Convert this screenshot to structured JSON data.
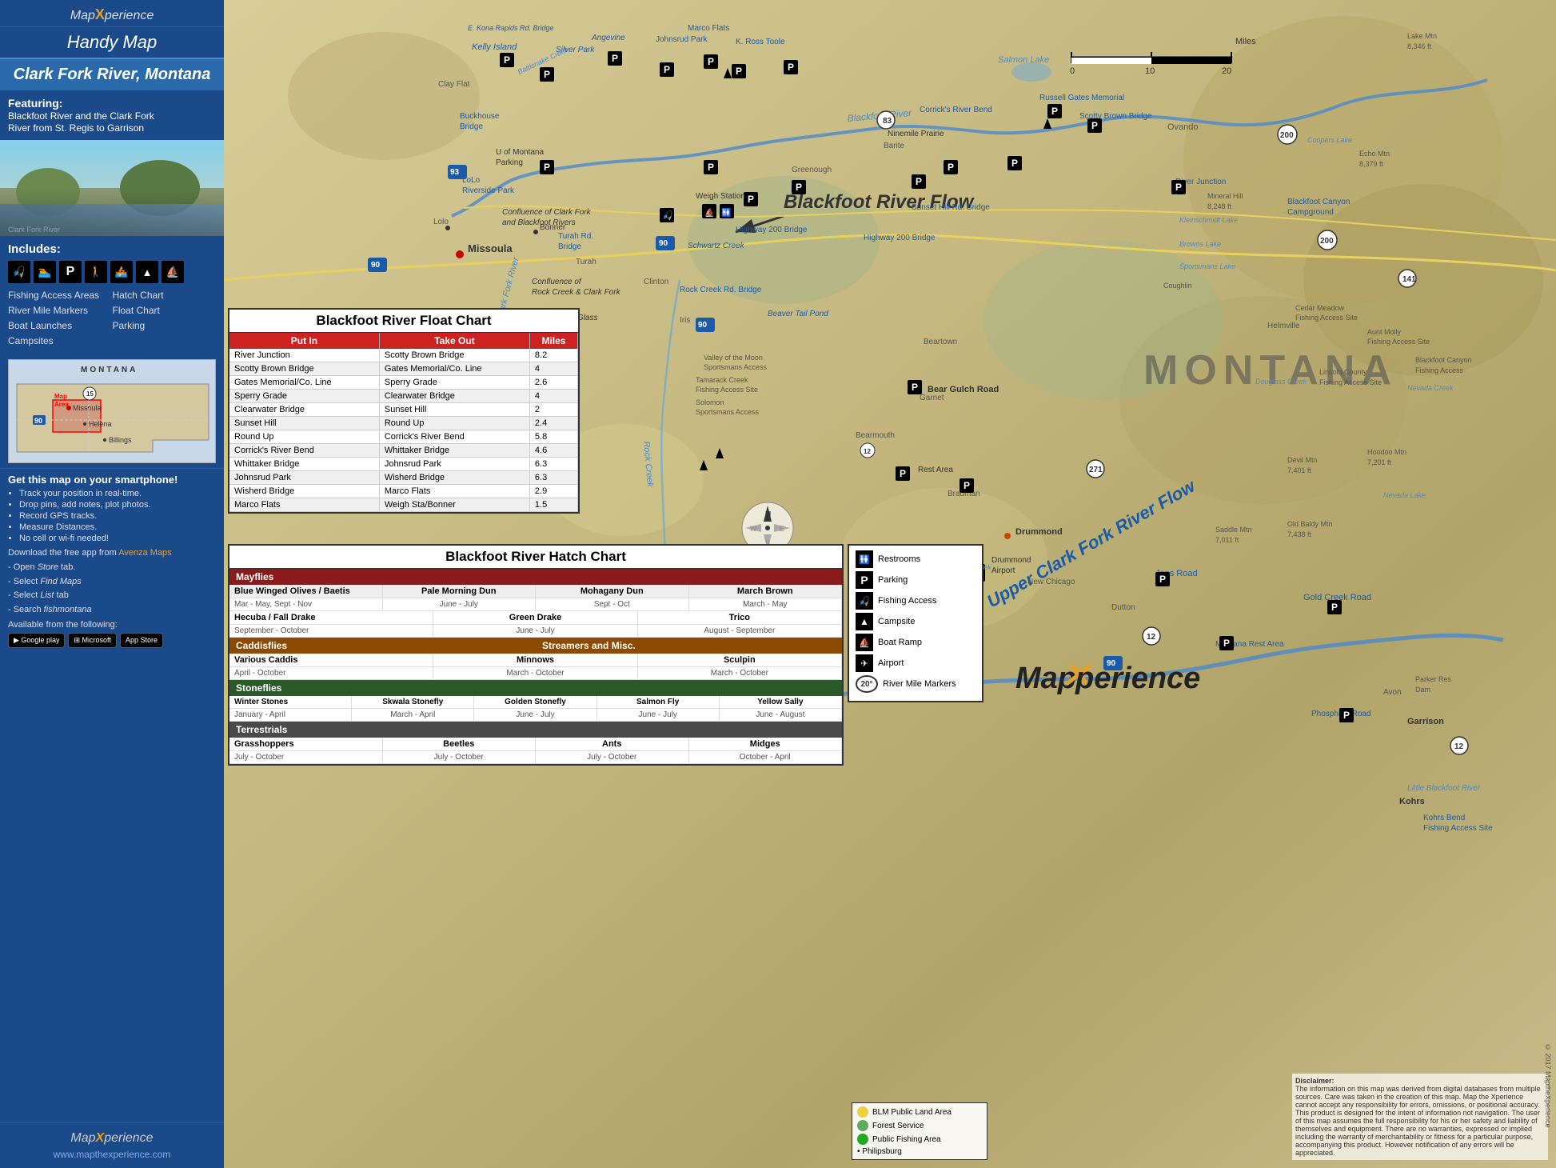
{
  "sidebar": {
    "logo": "Map",
    "logo_x": "X",
    "logo_suffix": "perience",
    "handy_map": "Handy Map",
    "river_title": "Clark Fork River, Montana",
    "featuring_label": "Featuring:",
    "featuring_text": "Blackfoot River and the Clark Fork\nRiver from St. Regis to Garrison",
    "includes_title": "Includes:",
    "includes_items": [
      "Fishing Access Areas",
      "Hatch Chart",
      "River Mile Markers",
      "Float Chart",
      "Boat Launches",
      "Parking",
      "Campsites",
      ""
    ],
    "smartphone_title": "Get this map on your smartphone!",
    "smartphone_bullets": [
      "Track your position in real-time.",
      "Drop pins, add notes, plot photos.",
      "Record GPS tracks.",
      "Measure Distances.",
      "No cell or wi-fi needed!"
    ],
    "download_text": "Download the free app from",
    "avenza_link": "Avenza Maps",
    "avenza_steps": [
      "- Open Store tab.",
      "- Select Find Maps",
      "- Select List tab",
      "- Search fishmontana"
    ],
    "available_from": "Available from the following:",
    "bottom_logo": "Map",
    "bottom_logo_x": "X",
    "bottom_logo_suffix": "perience",
    "website": "www.mapthexperience.com"
  },
  "map": {
    "title": "Clark Fork River, Montana",
    "scale_label": "Miles",
    "scale_0": "0",
    "scale_10": "10",
    "scale_20": "20",
    "blackfoot_flow": "Blackfoot River Flow",
    "upper_clark_flow": "Upper Clark Fork River Flow",
    "montana_label": "MONTANA",
    "map_xperience_logo": "Map",
    "map_xperience_x": "X",
    "map_xperience_suffix": "perience"
  },
  "float_chart": {
    "title": "Blackfoot River Float Chart",
    "col_put_in": "Put In",
    "col_take_out": "Take Out",
    "col_miles": "Miles",
    "rows": [
      {
        "put_in": "River Junction",
        "take_out": "Scotty Brown Bridge",
        "miles": "8.2"
      },
      {
        "put_in": "Scotty Brown Bridge",
        "take_out": "Gates Memorial/Co. Line",
        "miles": "4"
      },
      {
        "put_in": "Gates Memorial/Co. Line",
        "take_out": "Sperry Grade",
        "miles": "2.6"
      },
      {
        "put_in": "Sperry Grade",
        "take_out": "Clearwater Bridge",
        "miles": "4"
      },
      {
        "put_in": "Clearwater Bridge",
        "take_out": "Sunset Hill",
        "miles": "2"
      },
      {
        "put_in": "Sunset Hill",
        "take_out": "Round Up",
        "miles": "2.4"
      },
      {
        "put_in": "Round Up",
        "take_out": "Corrick's River Bend",
        "miles": "5.8"
      },
      {
        "put_in": "Corrick's River Bend",
        "take_out": "Whittaker Bridge",
        "miles": "4.6"
      },
      {
        "put_in": "Whittaker Bridge",
        "take_out": "Johnsrud Park",
        "miles": "6.3"
      },
      {
        "put_in": "Johnsrud Park",
        "take_out": "Wisherd Bridge",
        "miles": "6.3"
      },
      {
        "put_in": "Wisherd Bridge",
        "take_out": "Marco Flats",
        "miles": "2.9"
      },
      {
        "put_in": "Marco Flats",
        "take_out": "Weigh Sta/Bonner",
        "miles": "1.5"
      }
    ]
  },
  "hatch_chart": {
    "title": "Blackfoot River Hatch Chart",
    "mayflies_label": "Mayflies",
    "mayfly_cols": [
      "Blue Winged Olives / Baetis",
      "Pale Morning Dun",
      "Mohagany Dun",
      "March Brown"
    ],
    "mayfly_months": [
      "Mar - May, Sept - Nov",
      "June - July",
      "Sept - Oct",
      "March - May"
    ],
    "hecuba_label": "Hecuba / Fall Drake",
    "hecuba_months": "September - October",
    "green_drake_label": "Green Drake",
    "green_drake_months": "June - July",
    "trico_label": "Trico",
    "trico_months": "August - September",
    "caddis_label": "Caddisflies",
    "streams_label": "Streamers and Misc.",
    "various_caddis": "Various Caddis",
    "caddis_months": "April - October",
    "minnows": "Minnows",
    "minnows_months": "March - October",
    "sculpin": "Sculpin",
    "sculpin_months": "March - October",
    "stones_label": "Stoneflies",
    "stone_cols": [
      "Winter Stones",
      "Skwala Stonefly",
      "Golden Stonefly",
      "Salmon Fly",
      "Yellow Sally"
    ],
    "stone_months": [
      "January - April",
      "March - April",
      "June - July",
      "June - July",
      "June - August"
    ],
    "terrestrials_label": "Terrestrials",
    "terr_cols": [
      "Grasshoppers",
      "Beetles",
      "Ants",
      "Midges"
    ],
    "terr_months": [
      "July - October",
      "July - October",
      "July - October",
      "October - April"
    ]
  },
  "legend": {
    "items": [
      {
        "icon": "🚻",
        "label": "Restrooms"
      },
      {
        "icon": "P",
        "label": "Parking"
      },
      {
        "icon": "🎣",
        "label": "Fishing Access"
      },
      {
        "icon": "▲",
        "label": "Campsite"
      },
      {
        "icon": "⛵",
        "label": "Boat Ramp"
      },
      {
        "icon": "✈",
        "label": "Airport"
      },
      {
        "icon": "20",
        "label": "River Mile Markers"
      }
    ],
    "blm_color": "#f0d040",
    "blm_label": "BLM Public Land Area",
    "forest_color": "#60aa60",
    "forest_label": "Forest Service",
    "fishing_color": "#40aa40",
    "fishing_label": "Public Fishing Area",
    "philipsburg_label": "• Philipsburg"
  },
  "disclaimer": {
    "text": "The information on this map was derived from digital databases from multiple sources. Care was taken in the creation of this map. Map the Xperience cannot accept any responsibility for errors, omissions, or positional accuracy. This product is designed for the intent of information not navigation. The user of this map assumes the full responsibility for his or her safety and liability of themselves and equipment. There are no warranties, expressed or implied including the warranty of merchantability or fitness for a particular purpose, accompanying this product. However notification of any errors will be appreciated."
  },
  "copyright": "© 2017 MaptheXperience"
}
